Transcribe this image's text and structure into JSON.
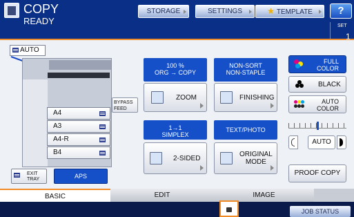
{
  "header": {
    "title": "COPY",
    "status": "READY",
    "set_label": "SET",
    "set_value": "1",
    "buttons": [
      {
        "label": "STORAGE"
      },
      {
        "label": "SETTINGS"
      },
      {
        "label": "TEMPLATE"
      }
    ],
    "help_label": "?"
  },
  "machine": {
    "auto_label": "AUTO",
    "bypass_label_1": "BYPASS",
    "bypass_label_2": "FEED",
    "trays": [
      "A4",
      "A3",
      "A4-R",
      "B4"
    ],
    "exit_tray_1": "EXIT",
    "exit_tray_2": "TRAY",
    "aps_label": "APS"
  },
  "zoom": {
    "info_1": "100 %",
    "info_2": "ORG → COPY",
    "button": "ZOOM"
  },
  "finishing": {
    "info_1": "NON-SORT",
    "info_2": "NON-STAPLE",
    "button": "FINISHING"
  },
  "sided": {
    "info_1": "1→1",
    "info_2": "SIMPLEX",
    "button": "2-SIDED"
  },
  "original": {
    "info": "TEXT/PHOTO",
    "button_1": "ORIGINAL",
    "button_2": "MODE"
  },
  "color": {
    "full_1": "FULL",
    "full_2": "COLOR",
    "black": "BLACK",
    "auto_1": "AUTO",
    "auto_2": "COLOR"
  },
  "density": {
    "auto_label": "AUTO",
    "level": 0.5
  },
  "proof_copy": "PROOF COPY",
  "tabs": [
    {
      "label": "BASIC"
    },
    {
      "label": "EDIT"
    },
    {
      "label": "IMAGE"
    }
  ],
  "job_status": "JOB STATUS",
  "colors": {
    "header": "#0a2f86",
    "accent": "#f08a24",
    "info_blue": "#1550c8"
  }
}
